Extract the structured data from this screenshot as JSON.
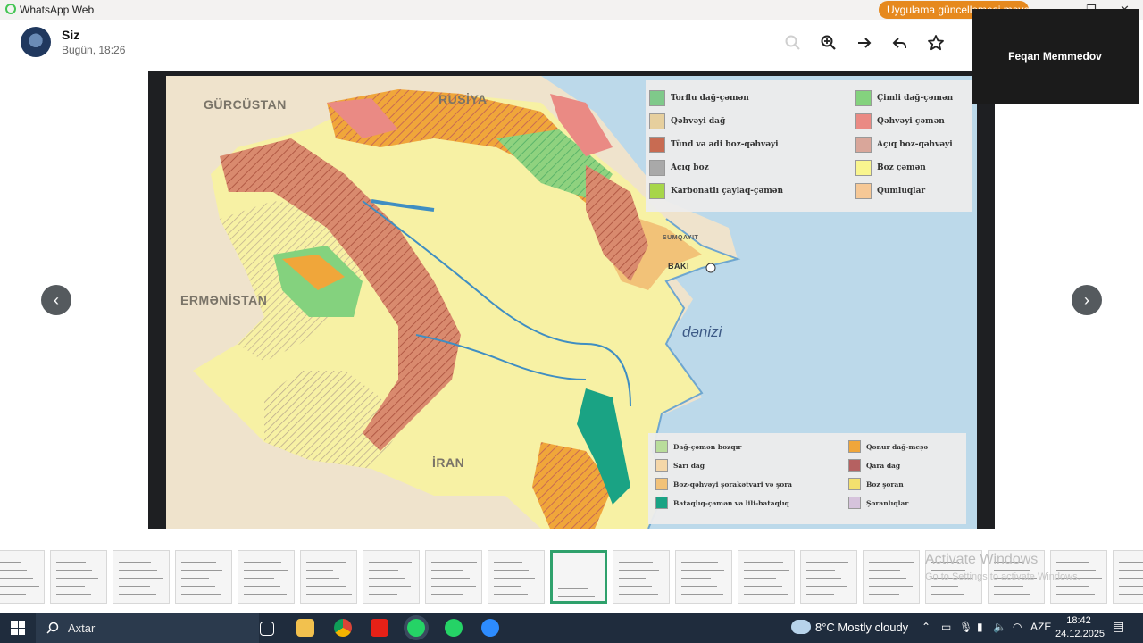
{
  "window": {
    "app_title": "WhatsApp Web",
    "update_notice": "Uygulama güncellemesi mevcut",
    "minimize": "—",
    "maximize": "❐",
    "close": "✕"
  },
  "header": {
    "sender": "Siz",
    "sent_time": "Bugün, 18:26",
    "actions": [
      "zoom-out-icon",
      "zoom-in-icon",
      "forward-icon",
      "reply-icon",
      "star-icon"
    ]
  },
  "video_call": {
    "participant": "Feqan Memmedov"
  },
  "map": {
    "countries": [
      "GÜRCÜSTAN",
      "RUSİYA",
      "ERMƏNİSTAN",
      "İRAN"
    ],
    "sea": "dənizi",
    "cities": [
      "BAKI",
      "SUMQAYIT"
    ],
    "legend_top": [
      {
        "label": "Torflu dağ-çəmən",
        "color": "#7fc98a"
      },
      {
        "label": "Çimli dağ-çəmən",
        "color": "#84d27e"
      },
      {
        "label": "Qəhvəyi dağ",
        "color": "#e6cf9e"
      },
      {
        "label": "Qəhvəyi çəmən",
        "color": "#ea8a84"
      },
      {
        "label": "Tünd və adi boz-qəhvəyi",
        "color": "#c86b52"
      },
      {
        "label": "Açıq boz-qəhvəyi",
        "color": "#d9a69a"
      },
      {
        "label": "Açıq boz",
        "color": "#a9a9a9"
      },
      {
        "label": "Boz çəmən",
        "color": "#f9f58f"
      },
      {
        "label": "Karbonatlı çaylaq-çəmən",
        "color": "#a7d64a"
      },
      {
        "label": "Qumluqlar",
        "color": "#f6c896"
      }
    ],
    "legend_bottom": [
      {
        "label": "Dağ-çəmən bozqır",
        "color": "#b9dd9b"
      },
      {
        "label": "Qonur dağ-meşə",
        "color": "#f0a63a"
      },
      {
        "label": "Sarı dağ",
        "color": "#f5d7a8"
      },
      {
        "label": "Qara dağ",
        "color": "#b56161"
      },
      {
        "label": "Boz-qəhvəyi şorakətvari və şora",
        "color": "#f2c278"
      },
      {
        "label": "Boz şoran",
        "color": "#f3e06e"
      },
      {
        "label": "Bataqlıq-çəmən və lili-bataqlıq",
        "color": "#1aa384"
      },
      {
        "label": "Şoranlıqlar",
        "color": "#d6c3dc"
      }
    ]
  },
  "viewer": {
    "prev": "‹",
    "next": "›"
  },
  "thumbnails": {
    "count": 19,
    "active_index": 9
  },
  "watermark": {
    "title": "Activate Windows",
    "subtitle": "Go to Settings to activate Windows."
  },
  "taskbar": {
    "search_placeholder": "Axtar",
    "weather": "8°C  Mostly cloudy",
    "language": "AZE",
    "time": "18:42",
    "date": "24.12.2025"
  }
}
